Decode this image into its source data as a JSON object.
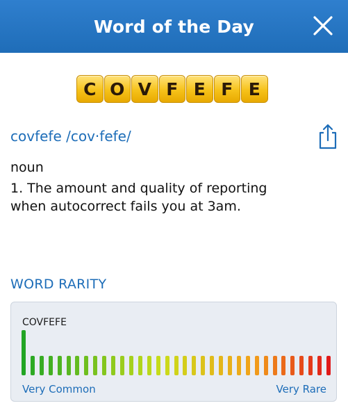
{
  "header": {
    "title": "Word of the Day",
    "close_icon": "close-icon"
  },
  "word": {
    "tiles": [
      "C",
      "O",
      "V",
      "F",
      "E",
      "F",
      "E"
    ],
    "headword": "covfefe /cov·fefe/",
    "part_of_speech": "noun",
    "definition": "1. The amount and quality of reporting when autocorrect fails you at 3am.",
    "share_icon": "share-icon"
  },
  "rarity": {
    "heading": "WORD RARITY",
    "word": "COVFEFE",
    "label_common": "Very Common",
    "label_rare": "Very Rare",
    "bar_count": 35,
    "highlighted_index": 0,
    "highlight_level": 1.0,
    "base_level": 0.43,
    "colors": {
      "start": "#22a524",
      "middle": "#c9dd1a",
      "orange": "#f2a21a",
      "end": "#e01a1a"
    }
  },
  "colors": {
    "header_bg": "#2277c6",
    "accent": "#1d6db8",
    "tile": "#f6c21a"
  }
}
